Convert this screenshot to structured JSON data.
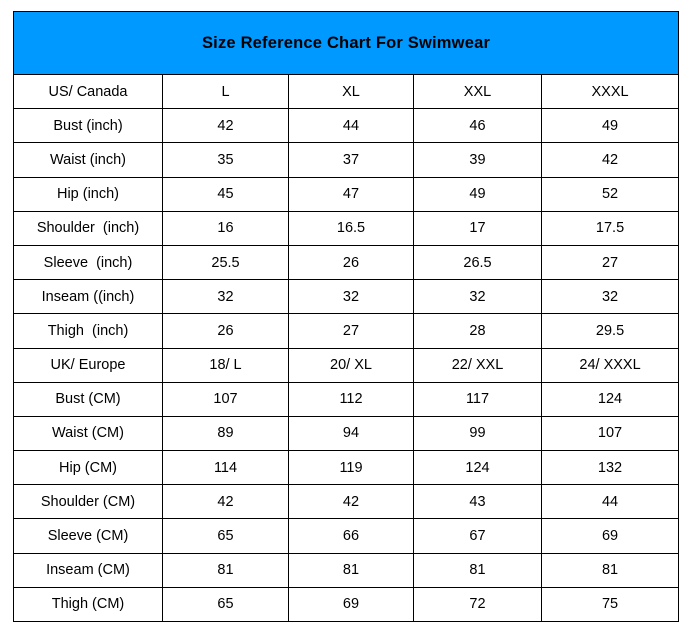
{
  "title": "Size Reference Chart For Swimwear",
  "colors": {
    "header_blue": "#0099ff",
    "border": "#000000",
    "text": "#000000",
    "background": "#ffffff"
  },
  "chart_data": {
    "type": "table",
    "title": "Size Reference Chart For Swimwear",
    "columns": [
      "US/ Canada",
      "L",
      "XL",
      "XXL",
      "XXXL"
    ],
    "rows": [
      {
        "label": "US/ Canada",
        "values": [
          "L",
          "XL",
          "XXL",
          "XXXL"
        ]
      },
      {
        "label": "Bust (inch)",
        "values": [
          "42",
          "44",
          "46",
          "49"
        ]
      },
      {
        "label": "Waist (inch)",
        "values": [
          "35",
          "37",
          "39",
          "42"
        ]
      },
      {
        "label": "Hip (inch)",
        "values": [
          "45",
          "47",
          "49",
          "52"
        ]
      },
      {
        "label": "Shoulder  (inch)",
        "values": [
          "16",
          "16.5",
          "17",
          "17.5"
        ]
      },
      {
        "label": "Sleeve  (inch)",
        "values": [
          "25.5",
          "26",
          "26.5",
          "27"
        ]
      },
      {
        "label": "Inseam ((inch)",
        "values": [
          "32",
          "32",
          "32",
          "32"
        ]
      },
      {
        "label": "Thigh  (inch)",
        "values": [
          "26",
          "27",
          "28",
          "29.5"
        ]
      },
      {
        "label": "UK/ Europe",
        "values": [
          "18/ L",
          "20/ XL",
          "22/ XXL",
          "24/ XXXL"
        ]
      },
      {
        "label": "Bust (CM)",
        "values": [
          "107",
          "112",
          "117",
          "124"
        ]
      },
      {
        "label": "Waist (CM)",
        "values": [
          "89",
          "94",
          "99",
          "107"
        ]
      },
      {
        "label": "Hip (CM)",
        "values": [
          "114",
          "119",
          "124",
          "132"
        ]
      },
      {
        "label": "Shoulder (CM)",
        "values": [
          "42",
          "42",
          "43",
          "44"
        ]
      },
      {
        "label": "Sleeve (CM)",
        "values": [
          "65",
          "66",
          "67",
          "69"
        ]
      },
      {
        "label": "Inseam (CM)",
        "values": [
          "81",
          "81",
          "81",
          "81"
        ]
      },
      {
        "label": "Thigh (CM)",
        "values": [
          "65",
          "69",
          "72",
          "75"
        ]
      }
    ]
  }
}
